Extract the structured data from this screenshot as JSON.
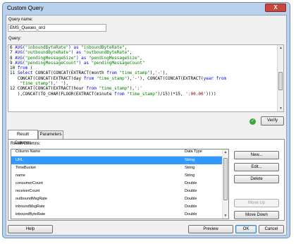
{
  "window": {
    "title": "Custom Query",
    "close_label": "X"
  },
  "query_name": {
    "label": "Query name:",
    "value": "EMS_Queues_orcl"
  },
  "query": {
    "label": "Query:",
    "lines": [
      [
        {
          "t": "6 ",
          "c": "ln"
        },
        {
          "t": "AVG(",
          "c": "k"
        },
        {
          "t": "\"inboundByteRate\"",
          "c": "s"
        },
        {
          "t": ") as ",
          "c": "k"
        },
        {
          "t": "\"inboundByteRate\"",
          "c": "s"
        },
        {
          "t": ",",
          "c": "ln"
        }
      ],
      [
        {
          "t": "7 ",
          "c": "ln"
        },
        {
          "t": "AVG(",
          "c": "k"
        },
        {
          "t": "\"outboundByteRate\"",
          "c": "s"
        },
        {
          "t": ") as ",
          "c": "k"
        },
        {
          "t": "\"outboundByteRate\"",
          "c": "s"
        },
        {
          "t": ",",
          "c": "ln"
        }
      ],
      [
        {
          "t": "8 ",
          "c": "ln"
        },
        {
          "t": "AVG(",
          "c": "k"
        },
        {
          "t": "\"pendingMessageSize\"",
          "c": "s"
        },
        {
          "t": ") as ",
          "c": "k"
        },
        {
          "t": "\"pendingMessageSize\"",
          "c": "s"
        },
        {
          "t": ",",
          "c": "ln"
        }
      ],
      [
        {
          "t": "9 ",
          "c": "ln"
        },
        {
          "t": "AVG(",
          "c": "k"
        },
        {
          "t": "\"pendingMessageCount\"",
          "c": "s"
        },
        {
          "t": ") as ",
          "c": "k"
        },
        {
          "t": "\"pendingMessageCount\"",
          "c": "s"
        }
      ],
      [
        {
          "t": "10 ",
          "c": "ln"
        },
        {
          "t": "from",
          "c": "k"
        },
        {
          "t": " (",
          "c": "ln"
        }
      ],
      [
        {
          "t": "11 ",
          "c": "ln"
        },
        {
          "t": "Select ",
          "c": "k"
        },
        {
          "t": "CONCAT(CONCAT(EXTRACT(month ",
          "c": "ln"
        },
        {
          "t": "from ",
          "c": "k"
        },
        {
          "t": "\"time_stamp\"",
          "c": "s"
        },
        {
          "t": "),",
          "c": "ln"
        },
        {
          "t": "'-'",
          "c": "m"
        },
        {
          "t": "),",
          "c": "ln"
        }
      ],
      [
        {
          "t": "   CONCAT(CONCAT(EXTRACT(day ",
          "c": "ln"
        },
        {
          "t": "from ",
          "c": "k"
        },
        {
          "t": "\"time_stamp\"",
          "c": "s"
        },
        {
          "t": "),",
          "c": "ln"
        },
        {
          "t": "'-'",
          "c": "m"
        },
        {
          "t": "), CONCAT(CONCAT(EXTRACT(",
          "c": "ln"
        },
        {
          "t": "year from",
          "c": "k"
        }
      ],
      [
        {
          "t": "    \"time_stamp\"",
          "c": "s"
        },
        {
          "t": "),",
          "c": "ln"
        },
        {
          "t": "' '",
          "c": "m"
        },
        {
          "t": "),",
          "c": "ln"
        }
      ],
      [
        {
          "t": "12 ",
          "c": "ln"
        },
        {
          "t": "CONCAT(CONCAT(EXTRACT(hour ",
          "c": "ln"
        },
        {
          "t": "from ",
          "c": "k"
        },
        {
          "t": "\"time_stamp\"",
          "c": "s"
        },
        {
          "t": "),",
          "c": "ln"
        },
        {
          "t": "':'",
          "c": "m"
        }
      ],
      [
        {
          "t": "   ),CONCAT(TO_CHAR(FLOOR(EXTRACT(minute ",
          "c": "ln"
        },
        {
          "t": "from ",
          "c": "k"
        },
        {
          "t": "\"time_stamp\"",
          "c": "s"
        },
        {
          "t": ")/15))*15, ",
          "c": "ln"
        },
        {
          "t": "':00.00'",
          "c": "m"
        },
        {
          "t": "))))",
          "c": "ln"
        }
      ]
    ]
  },
  "verify": {
    "label": "Verify"
  },
  "tabs": [
    {
      "label": "Result Columns"
    },
    {
      "label": "Parameters"
    }
  ],
  "result_columns": {
    "label": "Result columns:",
    "headers": [
      "Column Name",
      "Data Type"
    ],
    "rows": [
      {
        "name": "URL",
        "type": "String",
        "selected": true
      },
      {
        "name": "TimeBucket",
        "type": "String"
      },
      {
        "name": "name",
        "type": "String"
      },
      {
        "name": "consumerCount",
        "type": "Double"
      },
      {
        "name": "receiverCount",
        "type": "Double"
      },
      {
        "name": "outboundMsgRate",
        "type": "Double"
      },
      {
        "name": "inboundMsgRate",
        "type": "Double"
      },
      {
        "name": "inboundByteRate",
        "type": "Double"
      }
    ],
    "buttons": {
      "new": "New...",
      "edit": "Edit...",
      "delete": "Delete",
      "move_up": "Move Up",
      "move_down": "Move Down"
    }
  },
  "footer": {
    "help": "Help",
    "preview": "Preview",
    "ok": "OK",
    "cancel": "Cancel"
  },
  "colors": {
    "selection": "#3399ff",
    "window_frame": "#b9d1ea",
    "close": "#c7473a",
    "verify_ok": "#3aa83a"
  }
}
